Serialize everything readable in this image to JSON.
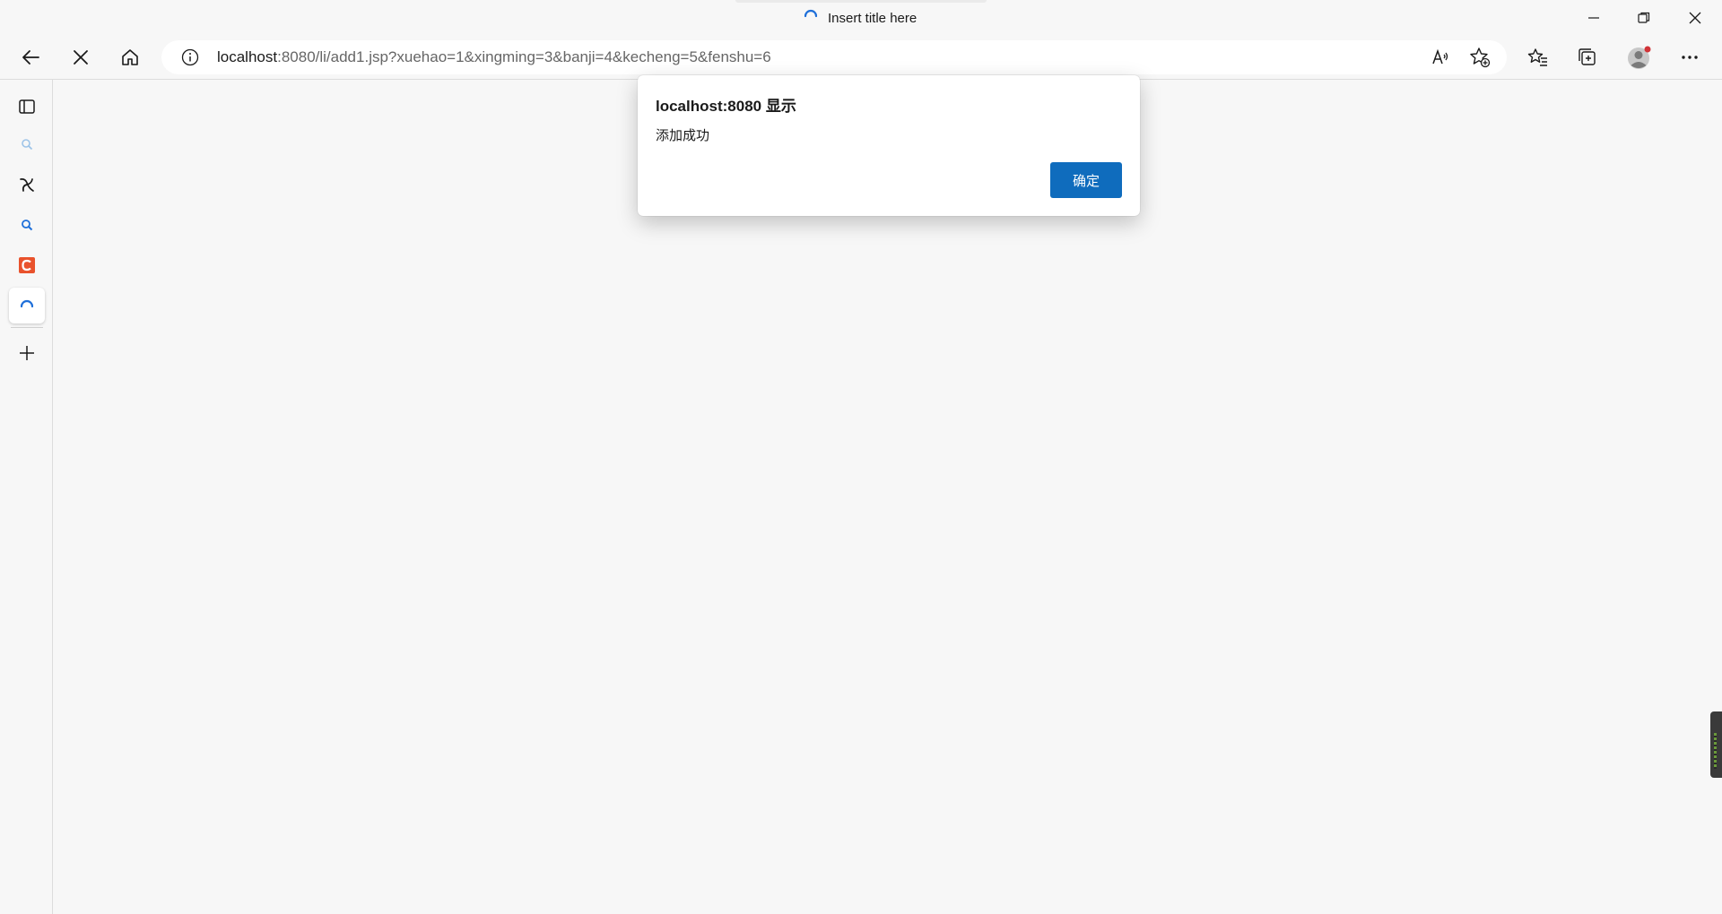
{
  "window": {
    "title": "Insert title here",
    "controls": {
      "minimize": "minimize",
      "restore": "restore",
      "close": "close"
    }
  },
  "toolbar": {
    "back": "back-arrow-icon",
    "stop": "close-icon",
    "home": "home-icon",
    "address": {
      "host": "localhost",
      "rest": ":8080/li/add1.jsp?xuehao=1&xingming=3&banji=4&kecheng=5&fenshu=6"
    },
    "right_icons": [
      "read-aloud-icon",
      "add-favorite-icon",
      "favorites-icon",
      "collections-icon",
      "profile-avatar",
      "more-icon"
    ]
  },
  "sidebar": {
    "items": [
      "tab-actions-icon",
      "search-icon",
      "copilot-icon",
      "search-icon",
      "c-app-icon",
      "loading-tab-icon",
      "add-icon"
    ]
  },
  "dialog": {
    "title": "localhost:8080 显示",
    "message": "添加成功",
    "ok_label": "确定"
  },
  "colors": {
    "accent": "#0f6cbd",
    "background": "#f7f7f7",
    "spinner": "#1e6fd9",
    "c_app": "#e9522c",
    "notify_dot": "#d13438"
  }
}
